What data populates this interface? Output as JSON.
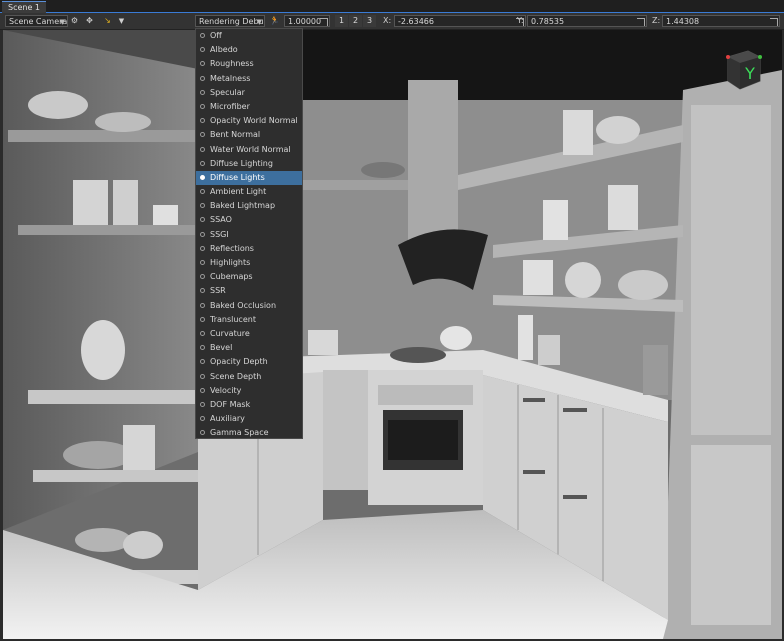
{
  "tab": {
    "label": "Scene 1"
  },
  "toolbar": {
    "camera": "Scene Camera",
    "render_mode": "Rendering Debug",
    "speed": "1.00000",
    "view_1": "1",
    "view_2": "2",
    "view_3": "3",
    "x_label": "X:",
    "x_value": "-2.63466",
    "y_label": "Y:",
    "y_value": "0.78535",
    "z_label": "Z:",
    "z_value": "1.44308"
  },
  "gizmo": {
    "axis_label": "Y"
  },
  "menu": {
    "selected": "Diffuse Lights",
    "items": [
      "Off",
      "Albedo",
      "Roughness",
      "Metalness",
      "Specular",
      "Microfiber",
      "Opacity World Normal",
      "Bent Normal",
      "Water World Normal",
      "Diffuse Lighting",
      "Diffuse Lights",
      "Ambient Light",
      "Baked Lightmap",
      "SSAO",
      "SSGI",
      "Reflections",
      "Highlights",
      "Cubemaps",
      "SSR",
      "Baked Occlusion",
      "Translucent",
      "Curvature",
      "Bevel",
      "Opacity Depth",
      "Scene Depth",
      "Velocity",
      "DOF Mask",
      "Auxiliary",
      "Gamma Space"
    ]
  },
  "colors": {
    "accent": "#3d6f9e",
    "toolbar": "#333333",
    "menu_bg": "#2e2e2e"
  }
}
